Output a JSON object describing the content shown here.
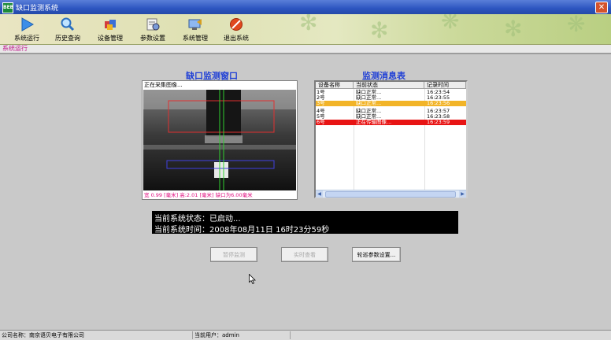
{
  "window": {
    "title": "缺口监测系统",
    "app_icon_text": "BEB"
  },
  "toolbar": {
    "items": [
      {
        "label": "系统运行",
        "icon": "play-icon"
      },
      {
        "label": "历史查询",
        "icon": "magnifier-icon"
      },
      {
        "label": "设备管理",
        "icon": "device-icon"
      },
      {
        "label": "参数设置",
        "icon": "settings-icon"
      },
      {
        "label": "系统管理",
        "icon": "system-icon"
      },
      {
        "label": "退出系统",
        "icon": "exit-icon"
      }
    ]
  },
  "section": {
    "title": "系统运行"
  },
  "camera": {
    "title": "缺口监测窗口",
    "capture_status": "正在采集图像...",
    "readout": "宽 0.99 [毫米]  高:2.01 [毫米]  缺口为6.00毫米"
  },
  "table": {
    "title": "监测消息表",
    "columns": [
      "设备名称",
      "当前状态",
      "记录时间"
    ],
    "rows": [
      {
        "device": "1号",
        "status": "缺口正常...",
        "time": "16:23:54",
        "state": "normal"
      },
      {
        "device": "2号",
        "status": "缺口正常...",
        "time": "16:23:55",
        "state": "normal"
      },
      {
        "device": "3号",
        "status": "缺口正常...",
        "time": "16:23:56",
        "state": "warning"
      },
      {
        "device": "4号",
        "status": "缺口正常...",
        "time": "16:23:57",
        "state": "normal"
      },
      {
        "device": "5号",
        "status": "缺口正常...",
        "time": "16:23:58",
        "state": "normal"
      },
      {
        "device": "6号",
        "status": "正在传输图像...",
        "time": "16:23:59",
        "state": "error"
      }
    ]
  },
  "status": {
    "line1": "当前系统状态：已启动...",
    "line2": "当前系统时间：2008年08月11日  16时23分59秒"
  },
  "buttons": {
    "pause": "暂停监测",
    "realtime": "实时查看",
    "params": "轮巡参数设置..."
  },
  "statusbar": {
    "company": "公司名称：南京语贝电子有限公司",
    "user": "当前用户：admin"
  },
  "colors": {
    "warning_row": "#f2b428",
    "error_row": "#e81414",
    "title_blue": "#1f3fd6"
  }
}
